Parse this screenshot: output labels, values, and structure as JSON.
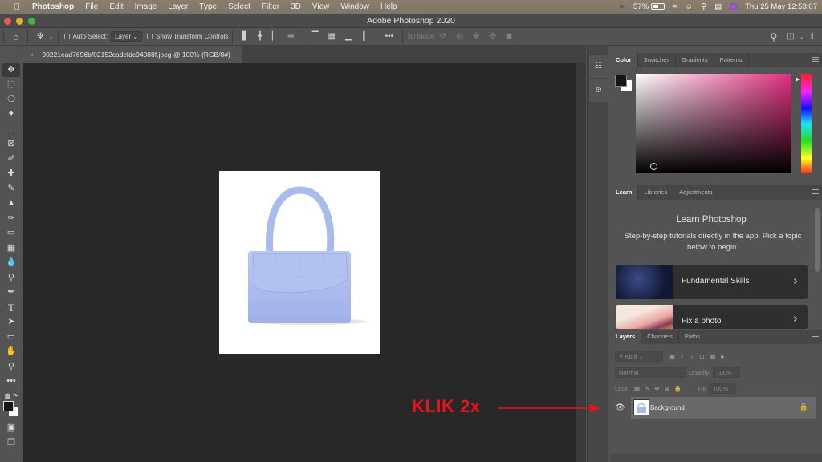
{
  "menubar": {
    "app_name": "Photoshop",
    "items": [
      "File",
      "Edit",
      "Image",
      "Layer",
      "Type",
      "Select",
      "Filter",
      "3D",
      "View",
      "Window",
      "Help"
    ],
    "battery": "57%",
    "battery_level": 0.57,
    "datetime": "Thu 25 May  12:53:07"
  },
  "window": {
    "title": "Adobe Photoshop 2020"
  },
  "options_bar": {
    "auto_select_label": "Auto-Select:",
    "auto_select_value": "Layer",
    "show_transform_label": "Show Transform Controls",
    "three_d_mode_label": "3D Mode:"
  },
  "document": {
    "tab_title": "90221ead7696bf02152cadcfdc94088f.jpeg @ 100% (RGB/8#)",
    "image_subject": "light blue croc-embossed mini handbag on white background"
  },
  "toolbar": {
    "tools": [
      "move",
      "marquee",
      "lasso",
      "magic-wand",
      "crop",
      "frame",
      "eyedropper",
      "healing-brush",
      "brush",
      "clone-stamp",
      "history-brush",
      "eraser",
      "gradient",
      "blur",
      "dodge",
      "pen",
      "type",
      "path-selection",
      "rectangle",
      "hand",
      "zoom",
      "more"
    ],
    "foreground_color": "#161616",
    "background_color": "#ffffff"
  },
  "color_panel": {
    "tabs": [
      "Color",
      "Swatches",
      "Gradients",
      "Patterns"
    ],
    "active_tab": "Color",
    "hue_color": "#e0307f"
  },
  "learn_panel": {
    "tabs": [
      "Learn",
      "Libraries",
      "Adjustments"
    ],
    "active_tab": "Learn",
    "title": "Learn Photoshop",
    "description": "Step-by-step tutorials directly in the app. Pick a topic below to begin.",
    "cards": [
      {
        "label": "Fundamental Skills"
      },
      {
        "label": "Fix a photo"
      }
    ]
  },
  "layers_panel": {
    "tabs": [
      "Layers",
      "Channels",
      "Paths"
    ],
    "active_tab": "Layers",
    "filter_placeholder": "Kind",
    "blend_mode": "Normal",
    "opacity_label": "Opacity:",
    "opacity_value": "100%",
    "lock_label": "Lock:",
    "fill_label": "Fill:",
    "fill_value": "100%",
    "layers": [
      {
        "name": "Background",
        "visible": true,
        "locked": true
      }
    ]
  },
  "annotation": {
    "text": "KLIK 2x",
    "color": "#e8141c"
  }
}
